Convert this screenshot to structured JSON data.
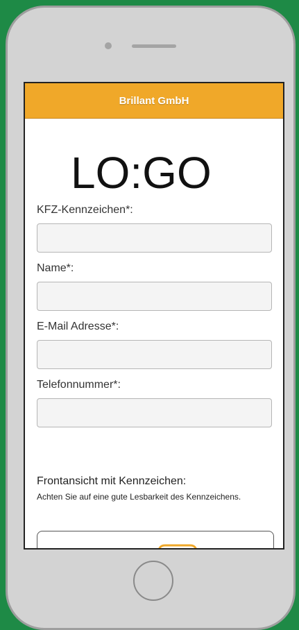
{
  "header": {
    "title": "Brillant GmbH",
    "background": "#f0a829"
  },
  "logo": {
    "text": "LO:GO"
  },
  "form": {
    "fields": [
      {
        "label": "KFZ-Kennzeichen*:",
        "value": "",
        "placeholder": ""
      },
      {
        "label": "Name*:",
        "value": "",
        "placeholder": ""
      },
      {
        "label": "E-Mail Adresse*:",
        "value": "",
        "placeholder": ""
      },
      {
        "label": "Telefonnummer*:",
        "value": "",
        "placeholder": ""
      }
    ],
    "photo_section": {
      "title": "Frontansicht mit Kennzeichen:",
      "hint": "Achten Sie auf eine gute Lesbarkeit des Kennzeichens.",
      "icon": "car-front-icon"
    }
  },
  "device": {
    "frame_color": "#d3d3d3",
    "background": "#1e8a46",
    "home_button_icon": "home-button"
  }
}
